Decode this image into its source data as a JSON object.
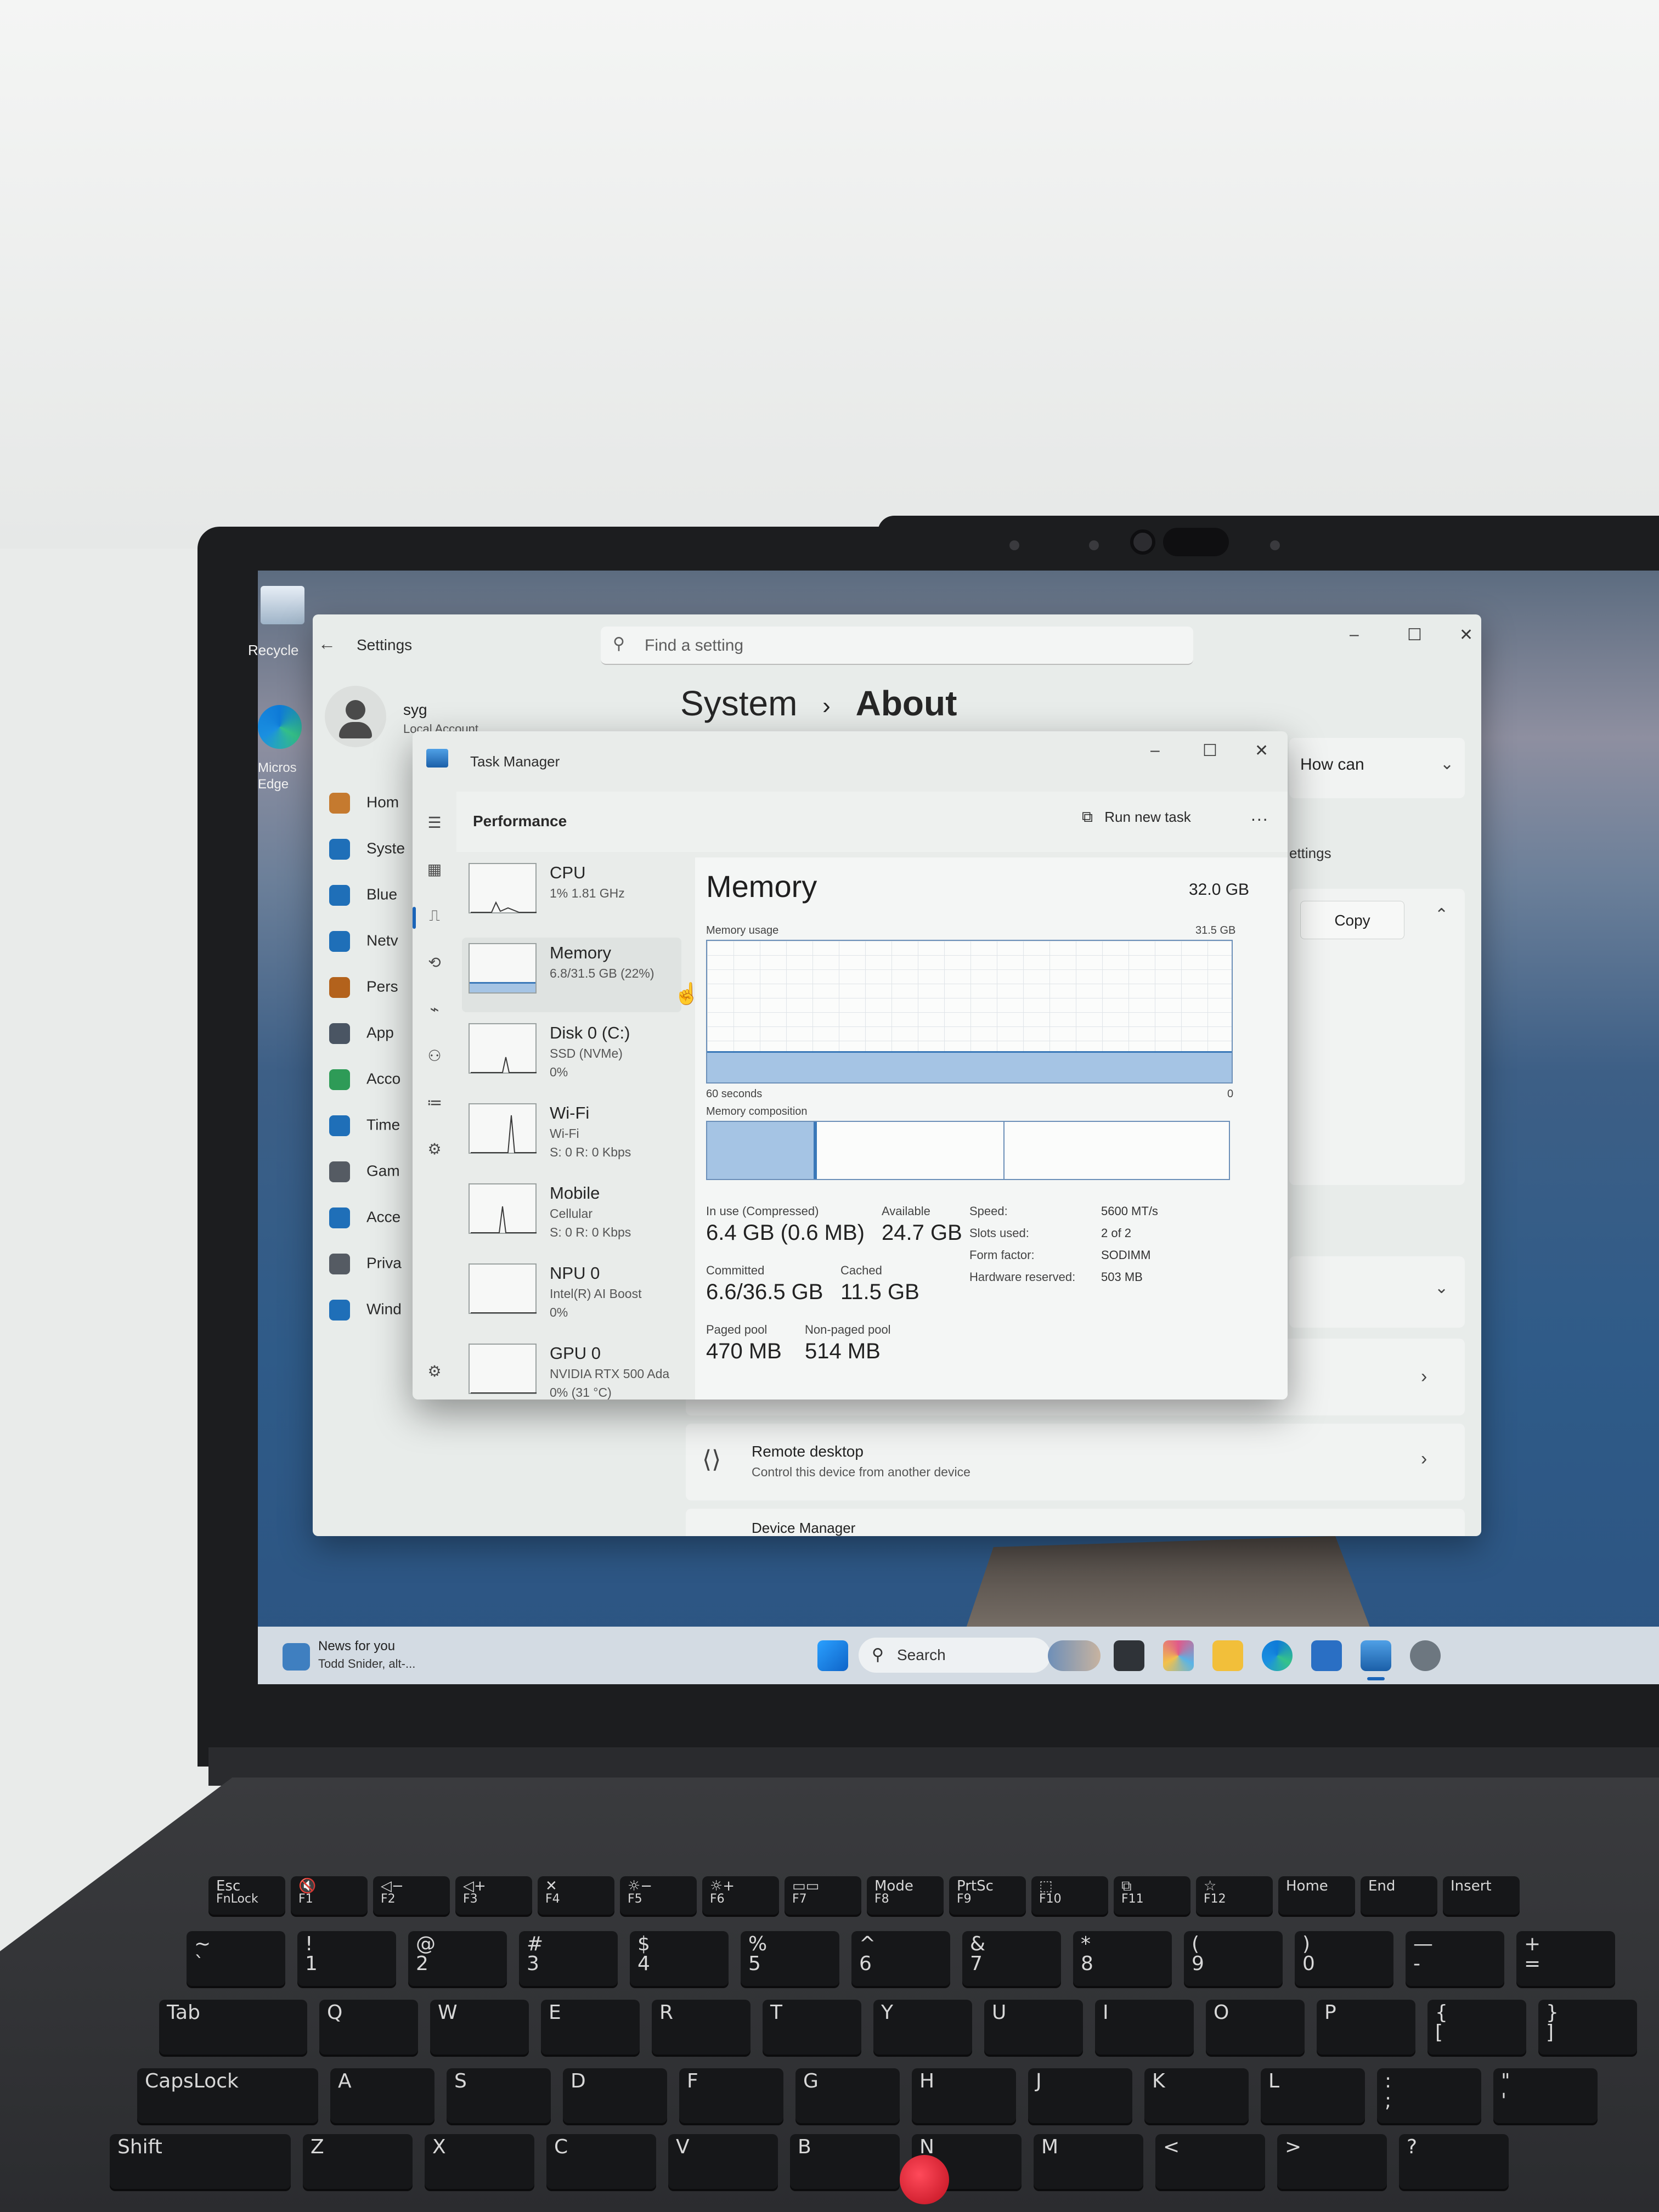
{
  "desktop": {
    "icons": [
      {
        "label": "Recycle",
        "icon": "recycle-bin-icon"
      },
      {
        "label": "Micros\nEdge",
        "icon": "edge-icon"
      }
    ]
  },
  "settings": {
    "title": "Settings",
    "search_placeholder": "Find a setting",
    "breadcrumb_parent": "System",
    "breadcrumb_sep": "›",
    "breadcrumb_current": "About",
    "user": {
      "name": "syg",
      "account": "Local Account"
    },
    "nav_items": [
      {
        "label": "Hom",
        "icon": "home-icon",
        "color": "#c57a2f"
      },
      {
        "label": "Syste",
        "icon": "system-icon",
        "color": "#1f6fb8"
      },
      {
        "label": "Blue",
        "icon": "bluetooth-icon",
        "color": "#1f6fb8"
      },
      {
        "label": "Netv",
        "icon": "wifi-icon",
        "color": "#1f6fb8"
      },
      {
        "label": "Pers",
        "icon": "brush-icon",
        "color": "#b3621c"
      },
      {
        "label": "App",
        "icon": "apps-icon",
        "color": "#4a5563"
      },
      {
        "label": "Acco",
        "icon": "account-icon",
        "color": "#2e9b57"
      },
      {
        "label": "Time",
        "icon": "clock-icon",
        "color": "#1f6fb8"
      },
      {
        "label": "Gam",
        "icon": "gamepad-icon",
        "color": "#555b63"
      },
      {
        "label": "Acce",
        "icon": "accessibility-icon",
        "color": "#1f6fb8"
      },
      {
        "label": "Priva",
        "icon": "shield-icon",
        "color": "#555b63"
      },
      {
        "label": "Wind",
        "icon": "update-icon",
        "color": "#1f6fb8"
      }
    ],
    "help_text": "How can",
    "related_settings": "ettings",
    "copy_label": "Copy",
    "remote_desktop": {
      "title": "Remote desktop",
      "subtitle": "Control this device from another device"
    },
    "device_manager": "Device Manager"
  },
  "task_manager": {
    "title": "Task Manager",
    "section": "Performance",
    "run_new_task": "Run new task",
    "more": "...",
    "list": [
      {
        "name": "CPU",
        "line1": "1% 1.81 GHz",
        "line2": ""
      },
      {
        "name": "Memory",
        "line1": "6.8/31.5 GB (22%)",
        "line2": ""
      },
      {
        "name": "Disk 0 (C:)",
        "line1": "SSD (NVMe)",
        "line2": "0%"
      },
      {
        "name": "Wi-Fi",
        "line1": "Wi-Fi",
        "line2": "S: 0 R: 0 Kbps"
      },
      {
        "name": "Mobile",
        "line1": "Cellular",
        "line2": "S: 0 R: 0 Kbps"
      },
      {
        "name": "NPU 0",
        "line1": "Intel(R) AI Boost",
        "line2": "0%"
      },
      {
        "name": "GPU 0",
        "line1": "NVIDIA RTX 500 Ada",
        "line2": "0% (31 °C)"
      }
    ],
    "memory": {
      "title": "Memory",
      "total": "32.0 GB",
      "usage_label": "Memory usage",
      "usage_max": "31.5 GB",
      "time_left": "60 seconds",
      "time_right": "0",
      "composition_label": "Memory composition",
      "usage_fraction": 0.22,
      "stats": [
        {
          "label": "In use (Compressed)",
          "value": "6.4 GB (0.6 MB)"
        },
        {
          "label": "Available",
          "value": "24.7 GB"
        },
        {
          "label": "Committed",
          "value": "6.6/36.5 GB"
        },
        {
          "label": "Cached",
          "value": "11.5 GB"
        },
        {
          "label": "Paged pool",
          "value": "470 MB"
        },
        {
          "label": "Non-paged pool",
          "value": "514 MB"
        }
      ],
      "specs": [
        {
          "key": "Speed:",
          "value": "5600 MT/s"
        },
        {
          "key": "Slots used:",
          "value": "2 of 2"
        },
        {
          "key": "Form factor:",
          "value": "SODIMM"
        },
        {
          "key": "Hardware reserved:",
          "value": "503 MB"
        }
      ]
    }
  },
  "taskbar": {
    "news_title": "News for you",
    "news_sub": "Todd Snider, alt-...",
    "search": "Search"
  },
  "keyboard": {
    "fn_row": [
      {
        "top": "Esc",
        "sub": "FnLock"
      },
      {
        "top": "🔇",
        "sub": "F1"
      },
      {
        "top": "◁−",
        "sub": "F2"
      },
      {
        "top": "◁+",
        "sub": "F3"
      },
      {
        "top": "✕",
        "sub": "F4"
      },
      {
        "top": "☼−",
        "sub": "F5"
      },
      {
        "top": "☼+",
        "sub": "F6"
      },
      {
        "top": "▭▭",
        "sub": "F7"
      },
      {
        "top": "Mode",
        "sub": "F8"
      },
      {
        "top": "PrtSc",
        "sub": "F9"
      },
      {
        "top": "⬚",
        "sub": "F10"
      },
      {
        "top": "⧉",
        "sub": "F11"
      },
      {
        "top": "☆",
        "sub": "F12"
      },
      {
        "top": "Home",
        "sub": ""
      },
      {
        "top": "End",
        "sub": ""
      },
      {
        "top": "Insert",
        "sub": ""
      }
    ],
    "num_row": [
      "~\n`",
      "!\n1",
      "@\n2",
      "#\n3",
      "$\n4",
      "%\n5",
      "^\n6",
      "&\n7",
      "*\n8",
      "(\n9",
      ")\n0",
      "—\n-",
      "+\n="
    ],
    "q_row": [
      "Tab",
      "Q",
      "W",
      "E",
      "R",
      "T",
      "Y",
      "U",
      "I",
      "O",
      "P",
      "{\n[",
      "}\n]"
    ],
    "a_row": [
      "CapsLock",
      "A",
      "S",
      "D",
      "F",
      "G",
      "H",
      "J",
      "K",
      "L",
      ":\n;",
      "\"\n'"
    ],
    "z_row": [
      "Shift",
      "Z",
      "X",
      "C",
      "V",
      "B",
      "N",
      "M",
      "<",
      ">",
      "?"
    ]
  }
}
